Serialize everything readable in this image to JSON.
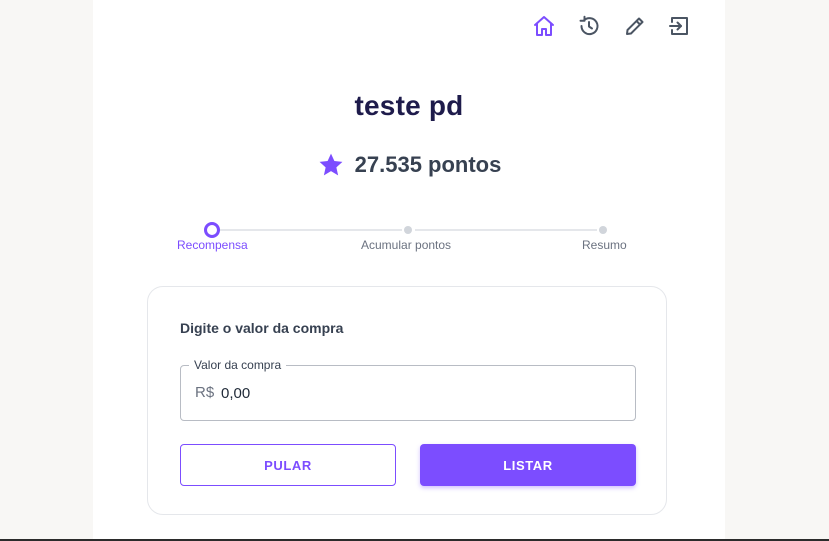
{
  "nav": {
    "icons": [
      "home-icon",
      "history-icon",
      "edit-icon",
      "logout-icon"
    ]
  },
  "profile": {
    "name": "teste pd",
    "points_label": "27.535 pontos"
  },
  "stepper": {
    "steps": [
      {
        "label": "Recompensa",
        "active": true
      },
      {
        "label": "Acumular pontos",
        "active": false
      },
      {
        "label": "Resumo",
        "active": false
      }
    ]
  },
  "form": {
    "title": "Digite o valor da compra",
    "field": {
      "label": "Valor da compra",
      "prefix": "R$",
      "value": "0,00"
    },
    "buttons": {
      "skip_label": "PULAR",
      "list_label": "LISTAR"
    }
  },
  "colors": {
    "accent": "#7c4dff",
    "title": "#1e1b4b",
    "text": "#374151"
  }
}
